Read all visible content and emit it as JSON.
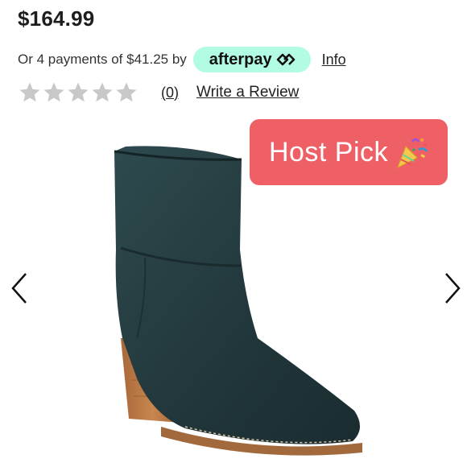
{
  "product": {
    "price": "$164.99",
    "image_alt": "green suede ankle boot"
  },
  "afterpay": {
    "prefix": "Or 4 payments of $41.25 by",
    "brand": "afterpay",
    "info_label": "Info",
    "badge_color": "#b2fce4"
  },
  "rating": {
    "stars_filled": 0,
    "stars_total": 5,
    "count_label": "(0)",
    "write_review_label": "Write a Review"
  },
  "badge": {
    "label": "Host Pick",
    "color": "#ee6065",
    "icon": "party-popper-icon"
  },
  "carousel": {
    "prev_icon": "chevron-left-icon",
    "next_icon": "chevron-right-icon"
  }
}
